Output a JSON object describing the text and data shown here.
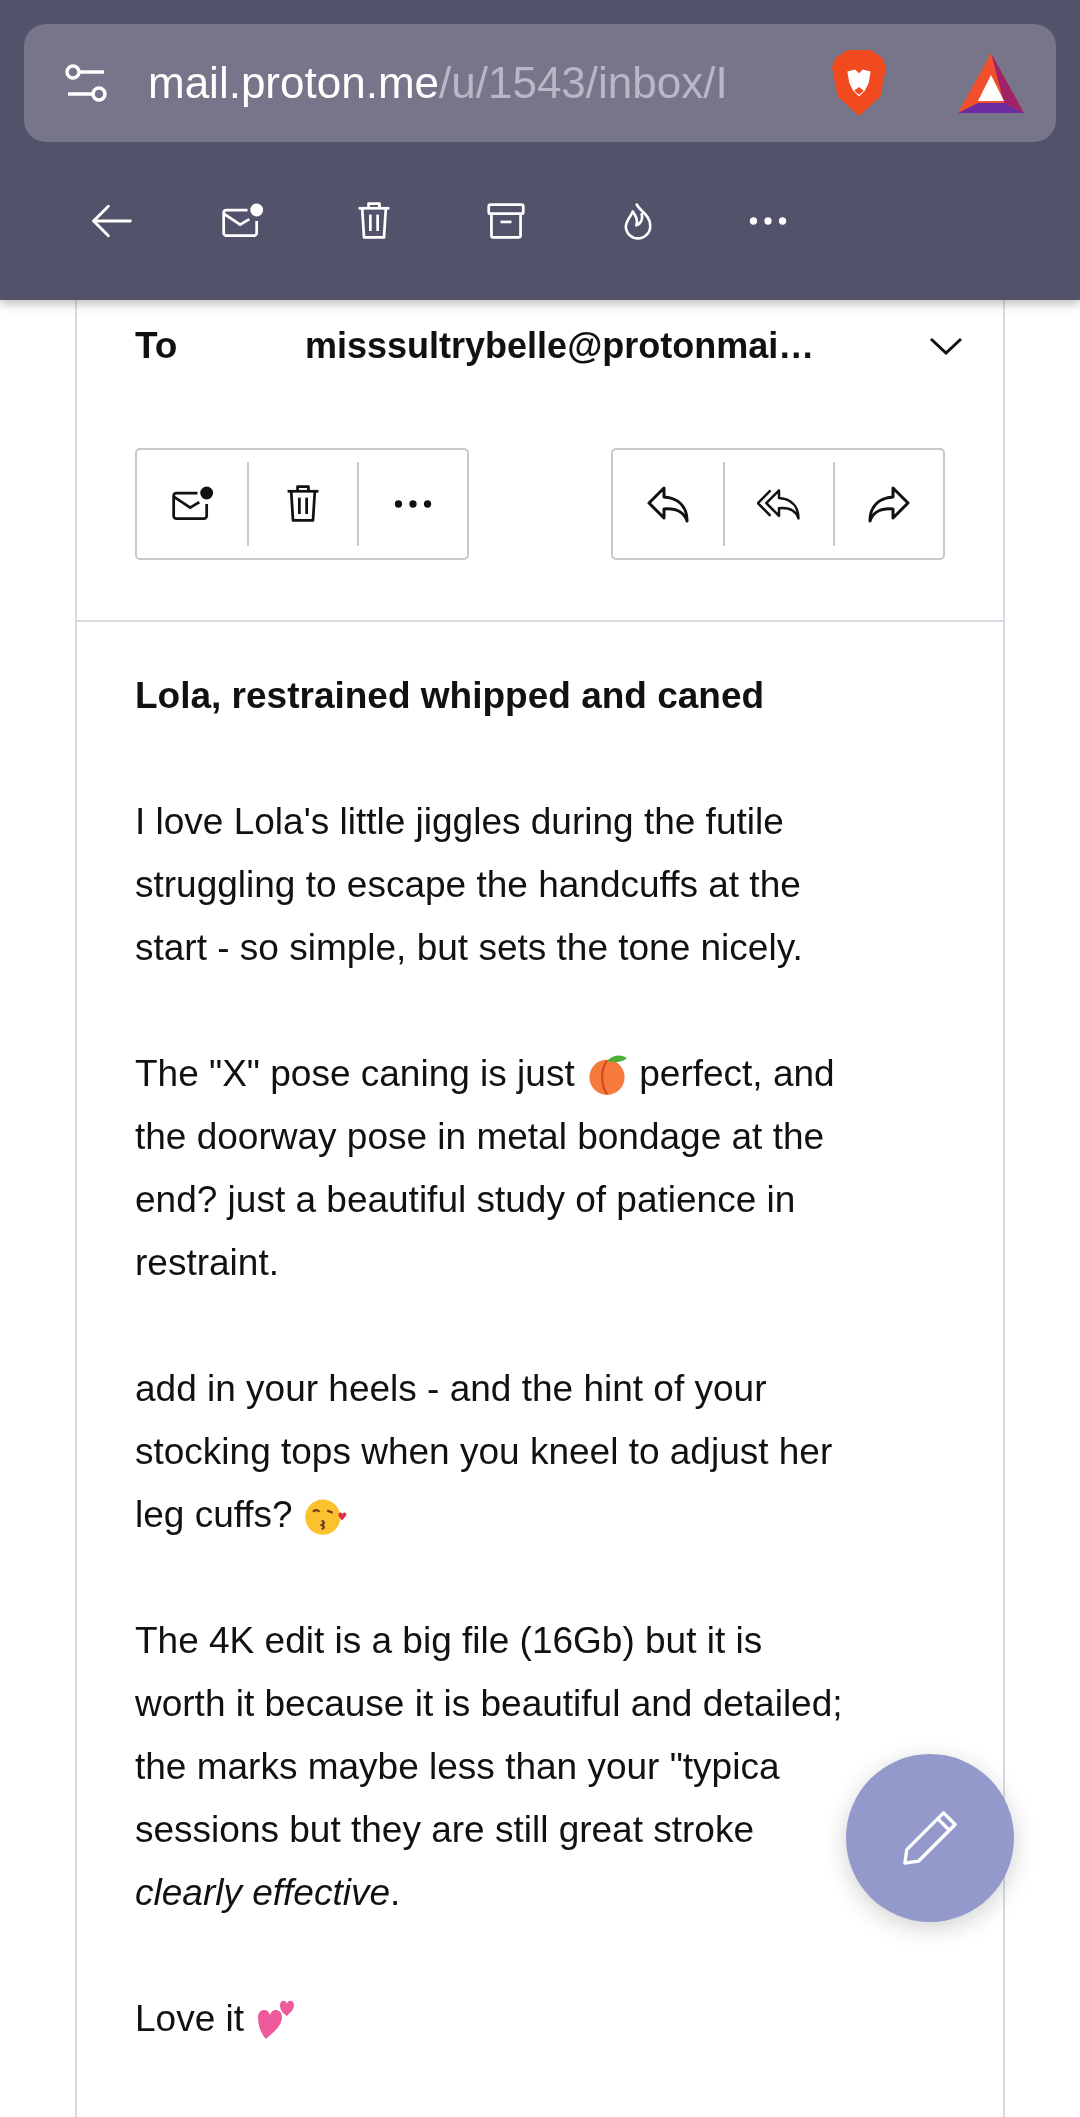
{
  "browser": {
    "url_host": "mail.proton.me",
    "url_path": "/u/1543/inbox/I"
  },
  "toolbar": [
    {
      "kind": "back"
    },
    {
      "kind": "unread"
    },
    {
      "kind": "trash"
    },
    {
      "kind": "archive"
    },
    {
      "kind": "fire"
    },
    {
      "kind": "more"
    }
  ],
  "message": {
    "to_label": "To",
    "to_address": "misssultrybelle@protonmai…",
    "left_actions": [
      {
        "kind": "unread"
      },
      {
        "kind": "trash"
      },
      {
        "kind": "more"
      }
    ],
    "right_actions": [
      {
        "kind": "reply"
      },
      {
        "kind": "reply_all"
      },
      {
        "kind": "forward"
      }
    ],
    "subject": "Lola, restrained whipped and caned",
    "paragraphs": [
      [
        [
          {
            "text": "I love Lola's little jiggles during the futile"
          }
        ],
        [
          {
            "text": "struggling to escape the handcuffs at the"
          }
        ],
        [
          {
            "text": "start - so simple, but sets the tone nicely."
          }
        ]
      ],
      [
        [
          {
            "text": "The \"X\" pose caning is just "
          },
          {
            "kind": "peach"
          },
          {
            "text": " perfect, and"
          }
        ],
        [
          {
            "text": "the doorway pose in metal bondage at the"
          }
        ],
        [
          {
            "text": "end? just a beautiful study of patience in"
          }
        ],
        [
          {
            "text": "restraint."
          }
        ]
      ],
      [
        [
          {
            "text": "add in your heels - and the hint of your"
          }
        ],
        [
          {
            "text": "stocking tops when you kneel to adjust her"
          }
        ],
        [
          {
            "text": "leg cuffs? "
          },
          {
            "kind": "kiss"
          }
        ]
      ],
      [
        [
          {
            "text": "The 4K edit is a big file (16Gb) but it is"
          }
        ],
        [
          {
            "text": "worth it because it is beautiful and detailed;"
          }
        ],
        [
          {
            "text": "the marks maybe less than your \"typica"
          }
        ],
        [
          {
            "text": "sessions but they are still great stroke"
          }
        ],
        [
          {
            "text": "*clearly effective*."
          }
        ]
      ],
      [
        [
          {
            "text": "Love it "
          },
          {
            "kind": "hearts"
          }
        ]
      ]
    ]
  },
  "compose_button": {
    "kind": "edit"
  }
}
